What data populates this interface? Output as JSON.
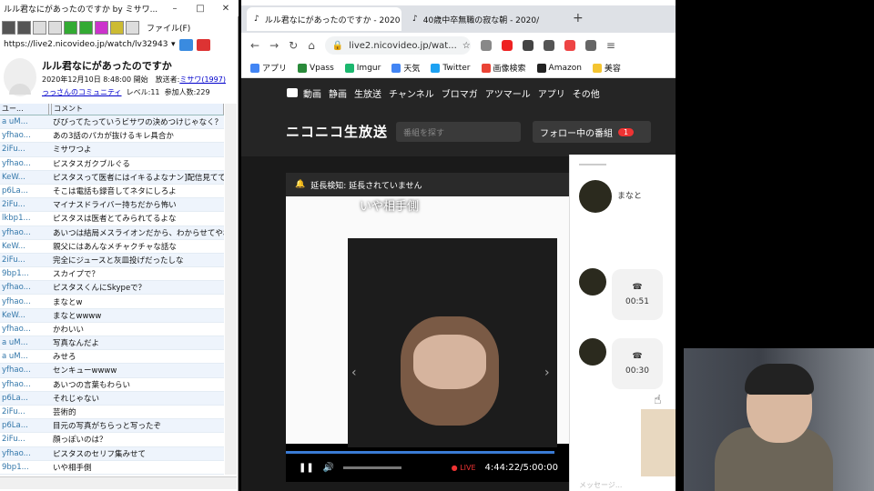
{
  "left_window": {
    "title": "ルル君なにがあったのですか by ミサワ...",
    "file_menu": "ファイル(F)",
    "url": "https://live2.nicovideo.jp/watch/lv329435",
    "stream_title": "ルル君なにがあったのですか",
    "date_text": "2020年12月10日 8:48:00 開始　放送者:",
    "broadcaster": "ミサワ(1997)",
    "community": "っっさんのコミュニティ",
    "level": "レベル:11",
    "participants": "参加人数:229",
    "columns": [
      "ユー...",
      "コメント"
    ],
    "comments": [
      {
        "user": "a uM...",
        "text": "びびってたっていうビサワの決めつけじゃなく？"
      },
      {
        "user": "yfhao...",
        "text": "あの3話のパカが抜けるキレ具合か"
      },
      {
        "user": "2iFu...",
        "text": "ミサワつよ"
      },
      {
        "user": "yfhao...",
        "text": "ピスタスガクブルぐる"
      },
      {
        "user": "KeW...",
        "text": "ピスタスって医者にはイキるよなナン]配信見てても思"
      },
      {
        "user": "p6La...",
        "text": "そこは電話も録音してネタにしろよ"
      },
      {
        "user": "2iFu...",
        "text": "マイナスドライバー持ちだから怖い"
      },
      {
        "user": "lkbp1...",
        "text": "ピスタスは医者とてみられてるよな"
      },
      {
        "user": "yfhao...",
        "text": "あいつは結局メスライオンだから、わからせてやれば問題"
      },
      {
        "user": "KeW...",
        "text": "親父にはあんなメチャクチャな話な"
      },
      {
        "user": "2iFu...",
        "text": "完全にジュースと灰皿投げだったしな"
      },
      {
        "user": "9bp1...",
        "text": "スカイプで？"
      },
      {
        "user": "yfhao...",
        "text": "ピスタスくんにSkypeで？"
      },
      {
        "user": "yfhao...",
        "text": "まなとw"
      },
      {
        "user": "KeW...",
        "text": "まなとwwww"
      },
      {
        "user": "yfhao...",
        "text": "かわいい"
      },
      {
        "user": "a uM...",
        "text": "写真なんだよ"
      },
      {
        "user": "a uM...",
        "text": "みせろ"
      },
      {
        "user": "yfhao...",
        "text": "センキューwwww"
      },
      {
        "user": "yfhao...",
        "text": "あいつの言葉もわらい"
      },
      {
        "user": "p6La...",
        "text": "それじゃない"
      },
      {
        "user": "2iFu...",
        "text": "芸術的"
      },
      {
        "user": "p6La...",
        "text": "目元の写真がちらっと写ったぞ"
      },
      {
        "user": "2iFu...",
        "text": "顔っぽいのは？"
      },
      {
        "user": "yfhao...",
        "text": "ピスタスのセリフ集みせて"
      },
      {
        "user": "9bp1...",
        "text": "いや相手側"
      }
    ]
  },
  "browser": {
    "tabs": [
      "ルル君なにがあったのですか - 2020",
      "40歳中卒無職の寂な朝 - 2020/"
    ],
    "url": "live2.nicovideo.jp/wat...",
    "bookmarks": [
      "アプリ",
      "Vpass",
      "Imgur",
      "天気",
      "Twitter",
      "画像検索",
      "Amazon",
      "美容"
    ],
    "nav_items": [
      "動画",
      "静画",
      "生放送",
      "チャンネル",
      "ブロマガ",
      "アツマール",
      "アプリ",
      "その他"
    ],
    "logo": "ニコニコ生放送",
    "search_placeholder": "番組を探す",
    "follow_label": "フォロー中の番組",
    "follow_count": "1"
  },
  "player": {
    "banner": "延長検知: 延長されていません",
    "overlay_text": "いや相手側",
    "time": "4:44:22/5:00:00",
    "live_label": "LIVE",
    "progress_fraction": 0.948
  },
  "dm": {
    "name": "まなと",
    "call1": "00:51",
    "call2": "00:30",
    "placeholder": "メッセージ..."
  },
  "colors": {
    "accent_blue": "#3a7bd5",
    "live_red": "#e33333",
    "nico_dark": "#252525"
  }
}
